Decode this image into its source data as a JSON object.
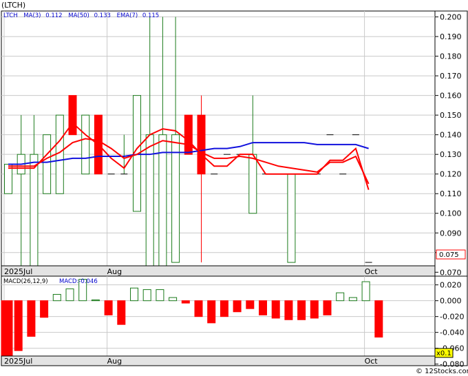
{
  "title": "(LTCH)",
  "watermark": "© 12Stocks.com",
  "colors": {
    "up": "#1a7a1a",
    "down": "#ff0000",
    "ma3": "#ff0000",
    "ma50": "#1010dd",
    "ema": "#ff0000",
    "legend": "#0000cc",
    "grid": "#c8c8c8",
    "axis": "#000000"
  },
  "chart_data": [
    {
      "type": "candlestick",
      "legend": {
        "symbol": "LTCH",
        "ma3_label": "MA(3)",
        "ma3_value": "0.112",
        "ma50_label": "MA(50)",
        "ma50_value": "0.133",
        "ema_label": "EMA(7)",
        "ema_value": "0.115"
      },
      "ylim": [
        0.068,
        0.203
      ],
      "yticks": [
        "0.200",
        "0.190",
        "0.180",
        "0.170",
        "0.160",
        "0.150",
        "0.140",
        "0.130",
        "0.120",
        "0.110",
        "0.100",
        "0.090",
        "0.080",
        "0.070"
      ],
      "xlabels": [
        {
          "label": "2025Jul",
          "i": 0
        },
        {
          "label": "Aug",
          "i": 8
        },
        {
          "label": "Oct",
          "i": 28
        }
      ],
      "last_price": "0.075",
      "candles": [
        {
          "o": 0.11,
          "h": 0.125,
          "l": 0.11,
          "c": 0.125
        },
        {
          "o": 0.12,
          "h": 0.15,
          "l": 0.07,
          "c": 0.13
        },
        {
          "o": 0.07,
          "h": 0.15,
          "l": 0.07,
          "c": 0.13
        },
        {
          "o": 0.11,
          "h": 0.14,
          "l": 0.11,
          "c": 0.14
        },
        {
          "o": 0.11,
          "h": 0.15,
          "l": 0.11,
          "c": 0.15
        },
        {
          "o": 0.16,
          "h": 0.16,
          "l": 0.14,
          "c": 0.14
        },
        {
          "o": 0.12,
          "h": 0.15,
          "l": 0.12,
          "c": 0.15
        },
        {
          "o": 0.15,
          "h": 0.15,
          "l": 0.12,
          "c": 0.12
        },
        {
          "o": 0.12,
          "h": 0.12,
          "l": 0.12,
          "c": 0.12
        },
        {
          "o": 0.12,
          "h": 0.14,
          "l": 0.12,
          "c": 0.12
        },
        {
          "o": 0.101,
          "h": 0.16,
          "l": 0.101,
          "c": 0.16
        },
        {
          "o": 0.07,
          "h": 0.2,
          "l": 0.07,
          "c": 0.14
        },
        {
          "o": 0.07,
          "h": 0.2,
          "l": 0.07,
          "c": 0.14
        },
        {
          "o": 0.075,
          "h": 0.2,
          "l": 0.075,
          "c": 0.14
        },
        {
          "o": 0.15,
          "h": 0.15,
          "l": 0.13,
          "c": 0.13
        },
        {
          "o": 0.15,
          "h": 0.16,
          "l": 0.075,
          "c": 0.12
        },
        {
          "o": 0.12,
          "h": 0.12,
          "l": 0.12,
          "c": 0.12
        },
        {
          "o": 0.13,
          "h": 0.13,
          "l": 0.13,
          "c": 0.13
        },
        {
          "o": 0.13,
          "h": 0.13,
          "l": 0.13,
          "c": 0.13
        },
        {
          "o": 0.1,
          "h": 0.16,
          "l": 0.1,
          "c": 0.13
        },
        {
          "o": 0.12,
          "h": 0.12,
          "l": 0.12,
          "c": 0.12
        },
        {
          "o": 0.12,
          "h": 0.12,
          "l": 0.12,
          "c": 0.12
        },
        {
          "o": 0.075,
          "h": 0.12,
          "l": 0.075,
          "c": 0.12
        },
        {
          "o": 0.12,
          "h": 0.12,
          "l": 0.12,
          "c": 0.12
        },
        {
          "o": 0.12,
          "h": 0.12,
          "l": 0.12,
          "c": 0.12
        },
        {
          "o": 0.14,
          "h": 0.14,
          "l": 0.14,
          "c": 0.14
        },
        {
          "o": 0.12,
          "h": 0.12,
          "l": 0.12,
          "c": 0.12
        },
        {
          "o": 0.14,
          "h": 0.14,
          "l": 0.14,
          "c": 0.14
        },
        {
          "o": 0.075,
          "h": 0.075,
          "l": 0.075,
          "c": 0.075
        }
      ],
      "series": [
        {
          "name": "MA(3)",
          "values": [
            0.123,
            0.123,
            0.123,
            0.13,
            0.137,
            0.146,
            0.14,
            0.135,
            0.128,
            0.123,
            0.133,
            0.14,
            0.143,
            0.142,
            0.137,
            0.13,
            0.124,
            0.124,
            0.13,
            0.13,
            0.12,
            0.12,
            0.12,
            0.12,
            0.12,
            0.127,
            0.127,
            0.133,
            0.112
          ]
        },
        {
          "name": "MA(50)",
          "values": [
            0.125,
            0.125,
            0.126,
            0.126,
            0.127,
            0.128,
            0.128,
            0.129,
            0.129,
            0.129,
            0.13,
            0.13,
            0.131,
            0.131,
            0.131,
            0.132,
            0.133,
            0.133,
            0.134,
            0.136,
            0.136,
            0.136,
            0.136,
            0.136,
            0.135,
            0.135,
            0.135,
            0.135,
            0.133
          ]
        },
        {
          "name": "EMA(7)",
          "values": [
            0.124,
            0.124,
            0.124,
            0.128,
            0.131,
            0.136,
            0.138,
            0.137,
            0.133,
            0.128,
            0.13,
            0.134,
            0.137,
            0.136,
            0.135,
            0.131,
            0.128,
            0.128,
            0.129,
            0.128,
            0.126,
            0.124,
            0.123,
            0.122,
            0.121,
            0.126,
            0.126,
            0.129,
            0.115
          ]
        }
      ]
    },
    {
      "type": "bar",
      "legend": {
        "label": "MACD(26,12,9)",
        "value_label": "MACD:",
        "value": "-0.046"
      },
      "ylim": [
        -0.082,
        0.031
      ],
      "yticks": [
        "0.020",
        "0.000",
        "-0.020",
        "-0.040",
        "-0.060",
        "-0.080"
      ],
      "xlabels": [
        {
          "label": "2025Jul",
          "i": 0
        },
        {
          "label": "Aug",
          "i": 8
        },
        {
          "label": "Oct",
          "i": 28
        }
      ],
      "scale_label": "x0.1",
      "values": [
        -0.085,
        -0.063,
        -0.045,
        -0.021,
        0.008,
        0.015,
        0.027,
        0.001,
        -0.018,
        -0.03,
        0.016,
        0.014,
        0.014,
        0.004,
        -0.003,
        -0.02,
        -0.028,
        -0.02,
        -0.014,
        -0.01,
        -0.018,
        -0.022,
        -0.024,
        -0.024,
        -0.022,
        -0.018,
        0.01,
        0.004,
        0.024,
        -0.046
      ]
    }
  ]
}
